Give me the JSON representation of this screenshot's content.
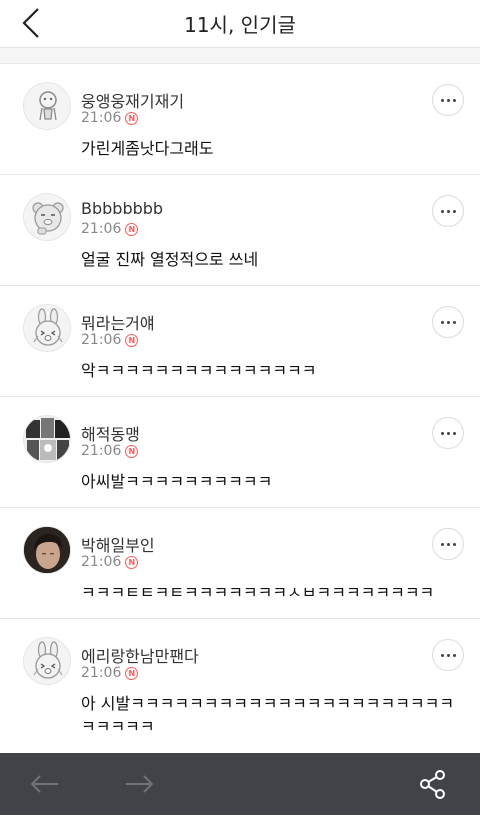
{
  "header": {
    "title": "11시, 인기글",
    "back_icon": "chevron-left-icon"
  },
  "colors": {
    "bottom_bar": "#404348",
    "new_badge": "#ff5a5a"
  },
  "new_badge_label": "N",
  "comments": [
    {
      "nickname": "웅앵웅재기재기",
      "time": "21:06",
      "text": "가린게좀낫다그래도",
      "avatar": "grey-bear-icon"
    },
    {
      "nickname": "Bbbbbbbb",
      "time": "21:06",
      "text": "얼굴 진짜 열정적으로 쓰네",
      "avatar": "ryan-bear-icon"
    },
    {
      "nickname": "뭐라는거얘",
      "time": "21:06",
      "text": "악ㅋㅋㅋㅋㅋㅋㅋㅋㅋㅋㅋㅋㅋㅋㅋ",
      "avatar": "crying-rabbit-icon"
    },
    {
      "nickname": "해적동맹",
      "time": "21:06",
      "text": "아씨발ㅋㅋㅋㅋㅋㅋㅋㅋㅋㅋ",
      "avatar": "manga-collage-avatar"
    },
    {
      "nickname": "박해일부인",
      "time": "21:06",
      "text": "ㅋㅋㅋㅌㅌㅋㅌㅋㅋㅋㅋㅋㅋㅋㅅㅂㅋㅋㅋㅋㅋㅋㅋㅋ",
      "avatar": "person-photo-avatar"
    },
    {
      "nickname": "에리랑한남만팬다",
      "time": "21:06",
      "text": "아 시발ㅋㅋㅋㅋㅋㅋㅋㅋㅋㅋㅋㅋㅋㅋㅋㅋㅋㅋㅋㅋㅋㅋㅋㅋㅋㅋㅋ",
      "avatar": "crying-rabbit-icon"
    }
  ],
  "bottom_bar": {
    "back_icon": "arrow-left-icon",
    "forward_icon": "arrow-right-icon",
    "share_icon": "share-icon"
  }
}
